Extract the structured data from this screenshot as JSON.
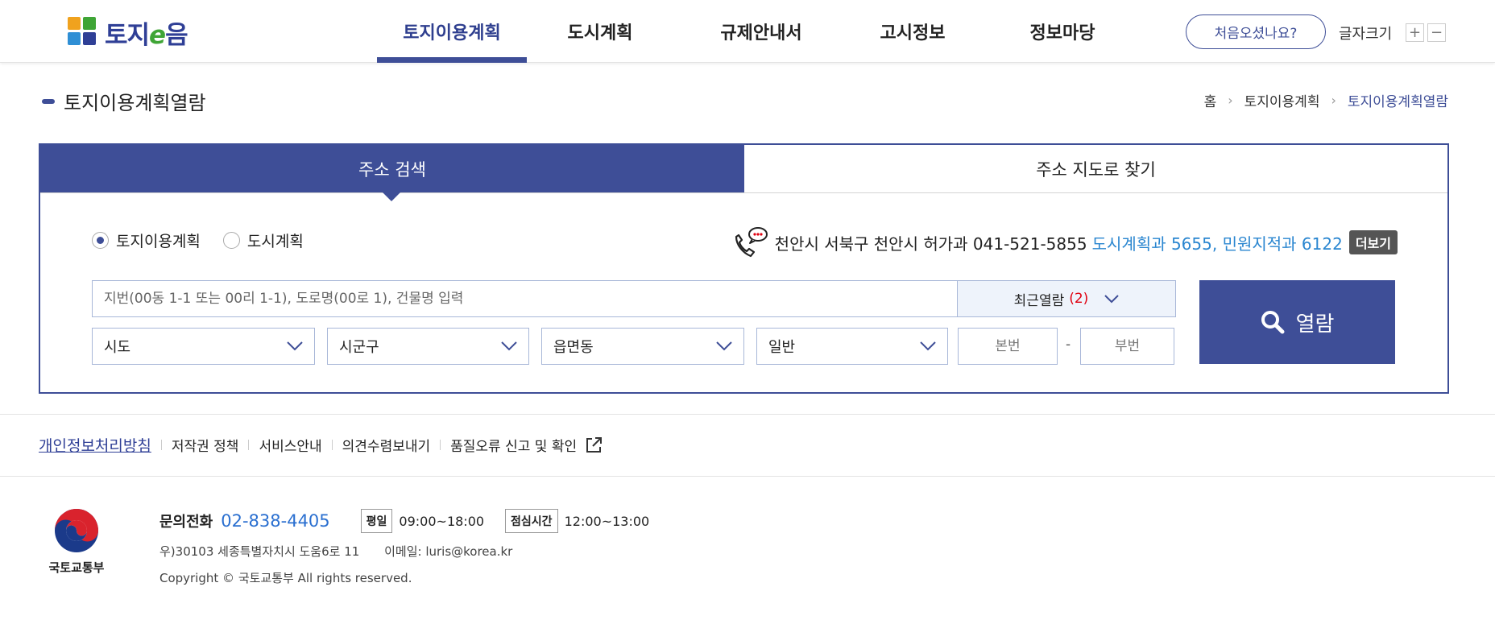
{
  "header": {
    "logo_text_a": "토지",
    "logo_text_e": "e",
    "logo_text_b": "음",
    "nav": [
      {
        "label": "토지이용계획",
        "active": true
      },
      {
        "label": "도시계획",
        "active": false
      },
      {
        "label": "규제안내서",
        "active": false
      },
      {
        "label": "고시정보",
        "active": false
      },
      {
        "label": "정보마당",
        "active": false
      }
    ],
    "first_visit": "처음오셨나요?",
    "font_size_label": "글자크기",
    "font_plus": "+",
    "font_minus": "−"
  },
  "page": {
    "title": "토지이용계획열람",
    "breadcrumb": [
      "홈",
      "토지이용계획",
      "토지이용계획열람"
    ]
  },
  "search": {
    "tabs": [
      "주소 검색",
      "주소 지도로 찾기"
    ],
    "radios": [
      {
        "label": "토지이용계획",
        "checked": true
      },
      {
        "label": "도시계획",
        "checked": false
      }
    ],
    "contact_plain": "천안시 서북구 천안시 허가과 041-521-5855",
    "contact_blue": "도시계획과 5655, 민원지적과 6122",
    "contact_more": "더보기",
    "address_placeholder": "지번(00동 1-1 또는 00리 1-1), 도로명(00로 1), 건물명 입력",
    "recent_label": "최근열람",
    "recent_count": "(2)",
    "view_button": "열람",
    "selects": [
      "시도",
      "시군구",
      "읍면동",
      "일반"
    ],
    "main_no_placeholder": "본번",
    "sub_no_placeholder": "부번",
    "dash": "-"
  },
  "footer": {
    "links": [
      "개인정보처리방침",
      "저작권 정책",
      "서비스안내",
      "의견수렴보내기",
      "품질오류 신고 및 확인"
    ],
    "ministry": "국토교통부",
    "tel_label": "문의전화",
    "tel": "02-838-4405",
    "weekday_badge": "평일",
    "weekday_time": "09:00~18:00",
    "lunch_badge": "점심시간",
    "lunch_time": "12:00~13:00",
    "address": "우)30103 세종특별자치시 도움6로 11",
    "email": "이메일: luris@korea.kr",
    "copyright": "Copyright © 국토교통부 All rights reserved."
  },
  "colors": {
    "primary": "#3e4e97",
    "link_blue": "#2a86d0",
    "count_red": "#e0000f"
  }
}
